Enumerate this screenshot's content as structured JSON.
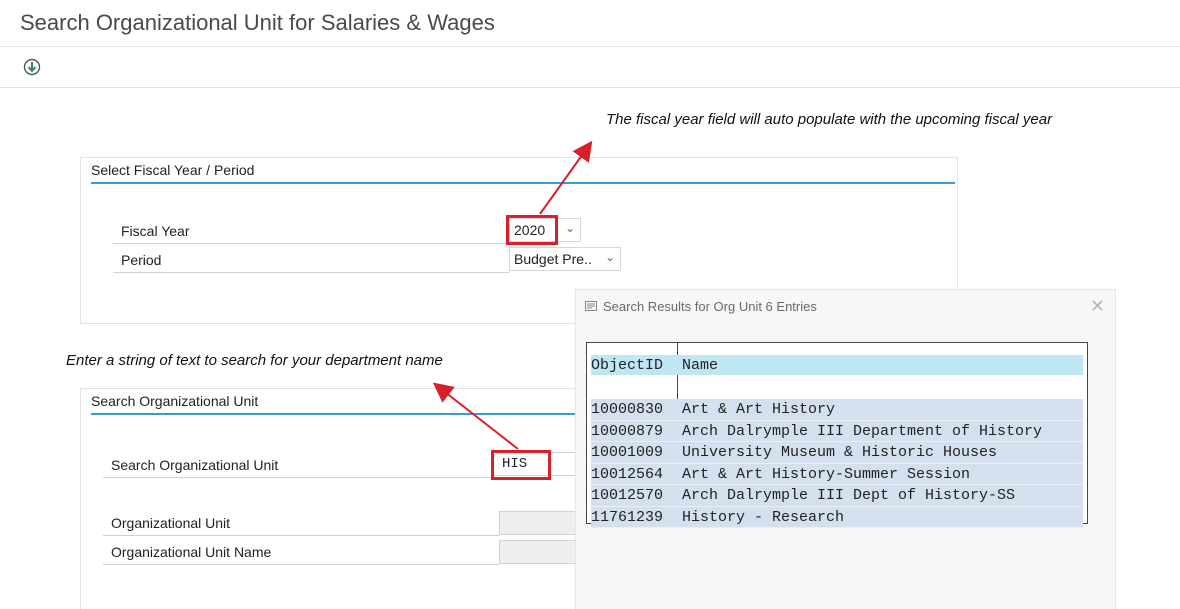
{
  "window": {
    "title": "Search Organizational Unit for Salaries & Wages"
  },
  "toolbar": {
    "execute_icon": "execute-icon"
  },
  "annotations": {
    "fiscal_year_note": "The fiscal year field will auto populate with the upcoming fiscal year",
    "search_note": "Enter a string of text to search for your department name",
    "highlight_color": "#d9202a"
  },
  "fiscal_panel": {
    "heading": "Select Fiscal Year / Period",
    "fiscal_year_label": "Fiscal Year",
    "fiscal_year_value": "2020",
    "period_label": "Period",
    "period_value": "Budget Pre.."
  },
  "search_panel": {
    "heading": "Search Organizational Unit",
    "search_label": "Search Organizational Unit",
    "search_value": "HIS",
    "org_unit_label": "Organizational Unit",
    "org_unit_value": "",
    "org_unit_name_label": "Organizational Unit Name",
    "org_unit_name_value": ""
  },
  "results_popup": {
    "title": "Search Results for Org Unit 6 Entries",
    "columns": [
      "ObjectID",
      "Name"
    ],
    "rows": [
      {
        "id": "10000830",
        "name": "Art & Art History"
      },
      {
        "id": "10000879",
        "name": "Arch Dalrymple III Department of History"
      },
      {
        "id": "10001009",
        "name": "University Museum & Historic Houses"
      },
      {
        "id": "10012564",
        "name": "Art & Art History-Summer Session"
      },
      {
        "id": "10012570",
        "name": "Arch Dalrymple III Dept of History-SS"
      },
      {
        "id": "11761239",
        "name": "History - Research"
      }
    ]
  },
  "colors": {
    "accent": "#3a9bd1",
    "row_highlight": "#d5e0ee",
    "header_highlight": "#bfe6f3"
  }
}
